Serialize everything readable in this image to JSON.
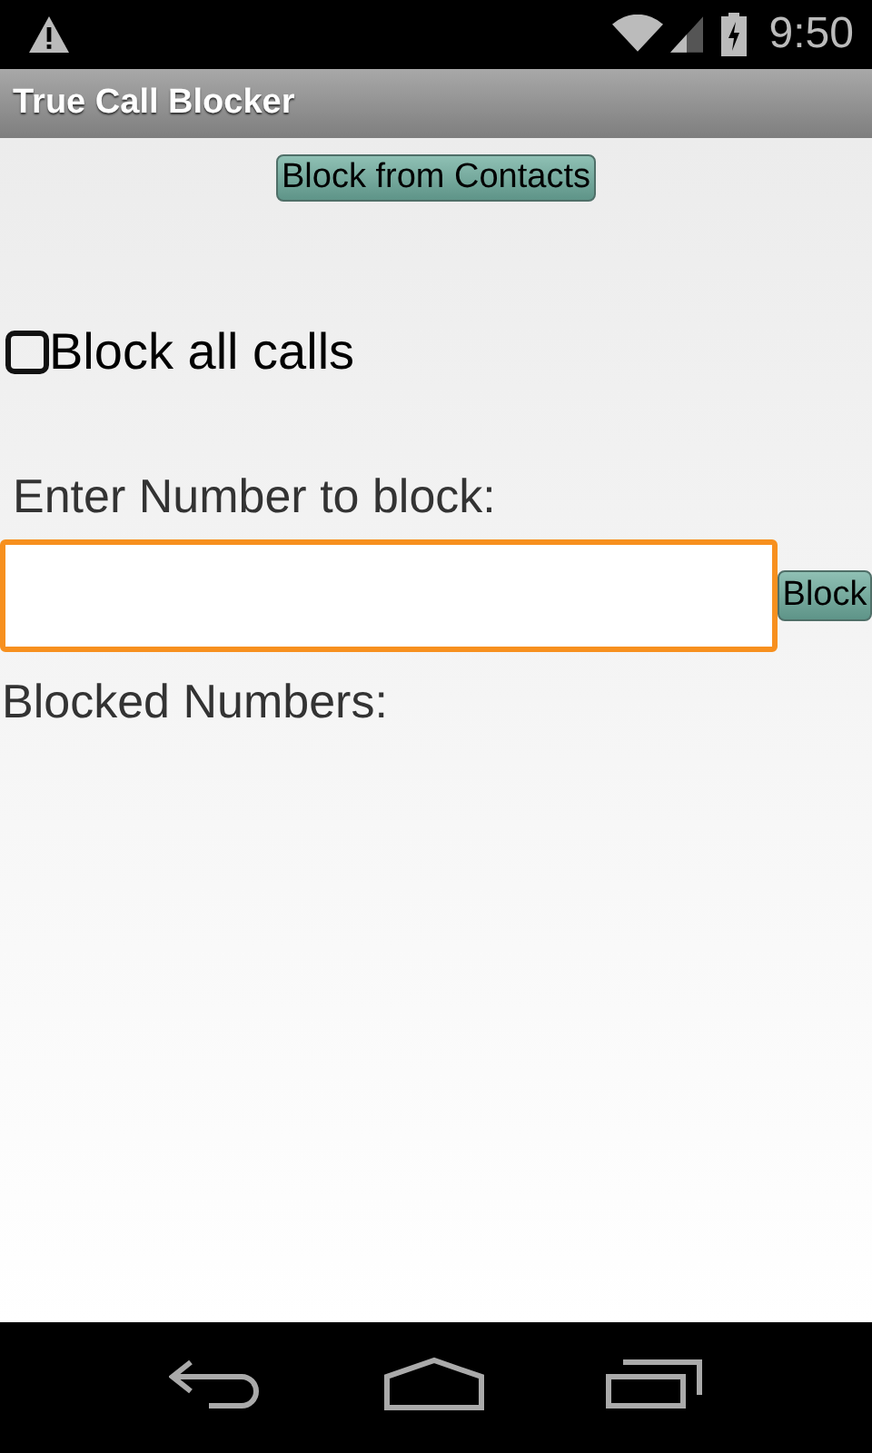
{
  "status_bar": {
    "time": "9:50"
  },
  "action_bar": {
    "title": "True Call Blocker"
  },
  "block_from_contacts_button": "Block from Contacts",
  "block_all": {
    "label": "Block all calls",
    "checked": false
  },
  "number_label": "Enter Number to block:",
  "number_field": {
    "focused": true
  },
  "block_button": "Block",
  "blocked_label": "Blocked Numbers:"
}
